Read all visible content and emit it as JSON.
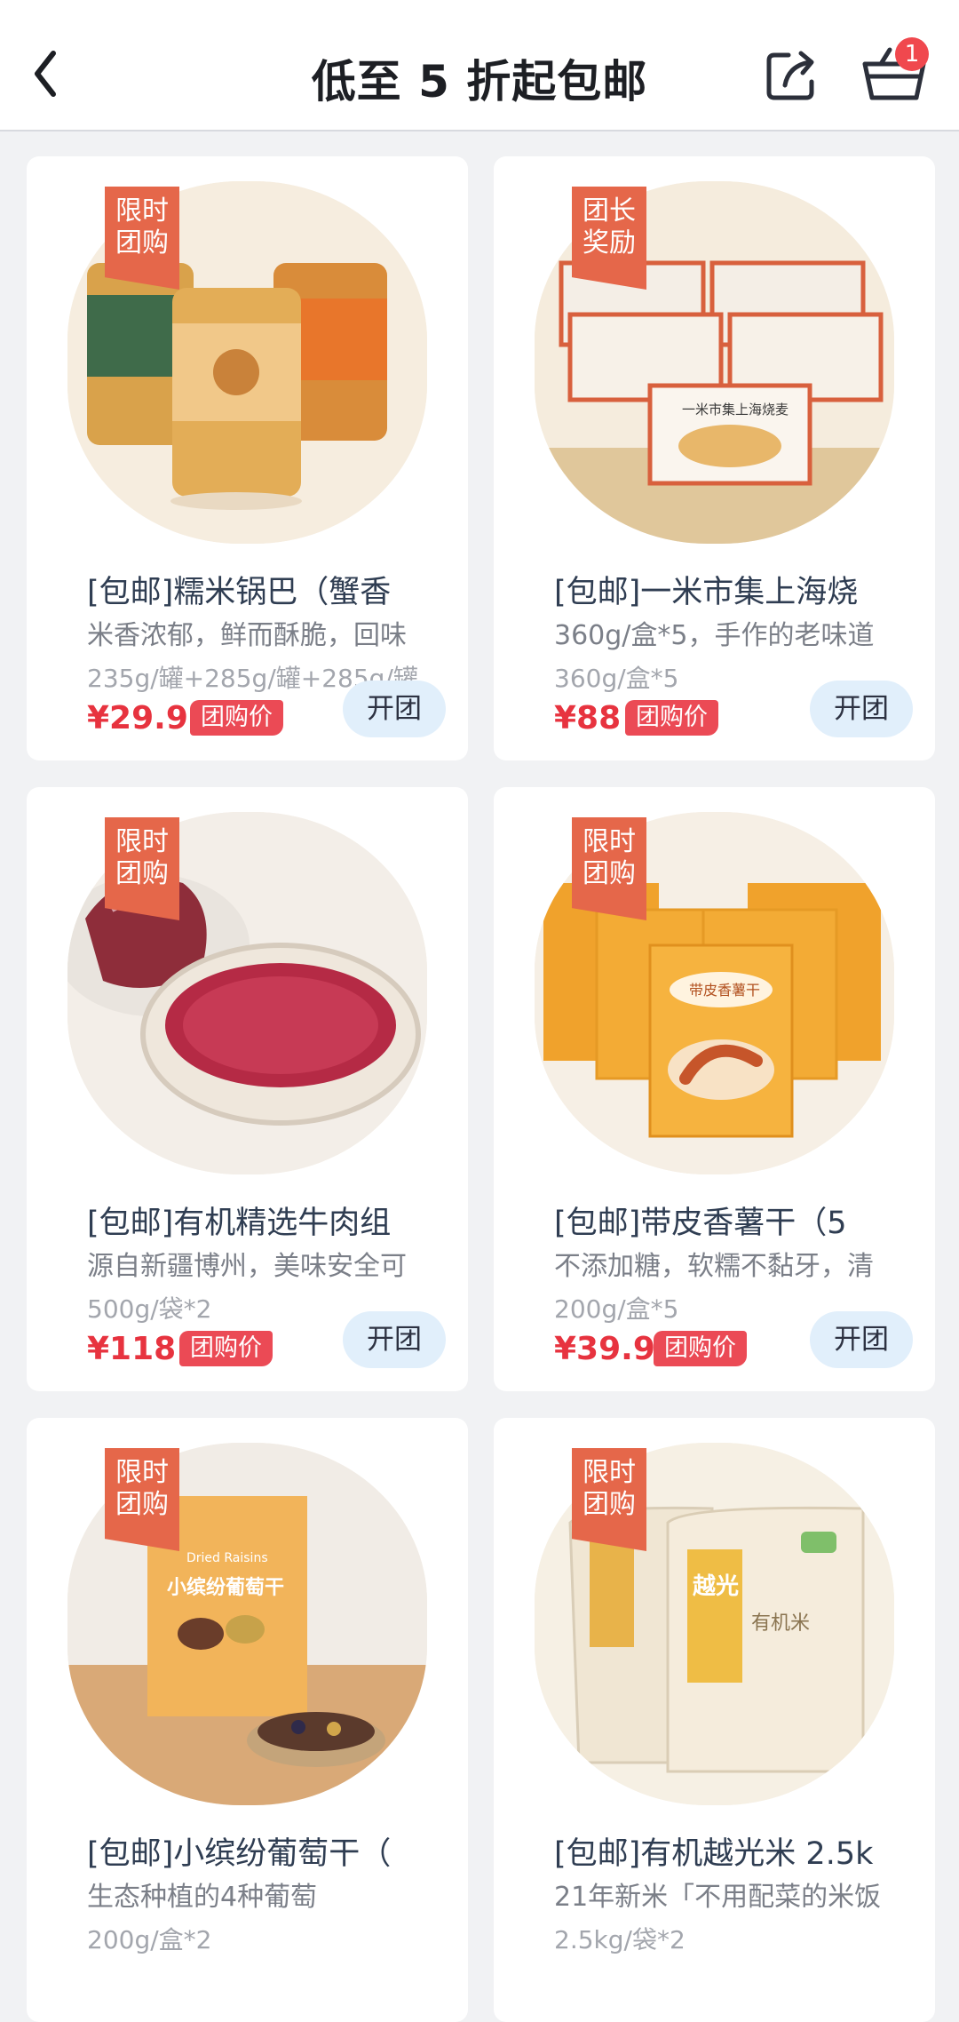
{
  "header": {
    "title": "低至 5 折起包邮",
    "cart_count": "1"
  },
  "products": [
    {
      "tag_line1": "限时",
      "tag_line2": "团购",
      "name": "[包邮]糯米锅巴（蟹香",
      "desc": "米香浓郁，鲜而酥脆，回味",
      "spec": "235g/罐+285g/罐+285g/罐",
      "price": "¥29.9",
      "group_label": "团购价",
      "open_label": "开团",
      "image": "jars-of-rice-crisps"
    },
    {
      "tag_line1": "团长",
      "tag_line2": "奖励",
      "name": "[包邮]一米市集上海烧",
      "desc": "360g/盒*5，手作的老味道",
      "spec": "360g/盒*5",
      "price": "¥88",
      "group_label": "团购价",
      "open_label": "开团",
      "image": "boxes-of-shaomai"
    },
    {
      "tag_line1": "限时",
      "tag_line2": "团购",
      "name": "[包邮]有机精选牛肉组",
      "desc": "源自新疆博州，美味安全可",
      "spec": "500g/袋*2",
      "price": "¥118",
      "group_label": "团购价",
      "open_label": "开团",
      "image": "raw-beef"
    },
    {
      "tag_line1": "限时",
      "tag_line2": "团购",
      "name": "[包邮]带皮香薯干（5",
      "desc": "不添加糖，软糯不黏牙，清",
      "spec": "200g/盒*5",
      "price": "¥39.9",
      "group_label": "团购价",
      "open_label": "开团",
      "image": "dried-sweet-potato-boxes"
    },
    {
      "tag_line1": "限时",
      "tag_line2": "团购",
      "name": "[包邮]小缤纷葡萄干（",
      "desc": "生态种植的4种葡萄",
      "spec": "200g/盒*2",
      "price": "",
      "group_label": "",
      "open_label": "",
      "image": "raisin-box"
    },
    {
      "tag_line1": "限时",
      "tag_line2": "团购",
      "name": "[包邮]有机越光米 2.5k",
      "desc": "21年新米「不用配菜的米饭",
      "spec": "2.5kg/袋*2",
      "price": "",
      "group_label": "",
      "open_label": "",
      "image": "rice-bags"
    }
  ],
  "product_images_text": {
    "p2_box_label": "一米市集上海烧麦",
    "p4_box_label": "带皮香薯干",
    "p5_box_title": "小缤纷葡萄干",
    "p5_box_en": "Dried Raisins",
    "p6_bag_big": "越光",
    "p6_bag_small": "有机米"
  },
  "colors": {
    "accent_red": "#e7333f",
    "tag_orange": "#e5674a",
    "open_button_bg": "#e1effb",
    "page_bg": "#f1f2f4"
  },
  "icons": [
    "back-arrow-icon",
    "share-icon",
    "shopping-basket-icon"
  ]
}
